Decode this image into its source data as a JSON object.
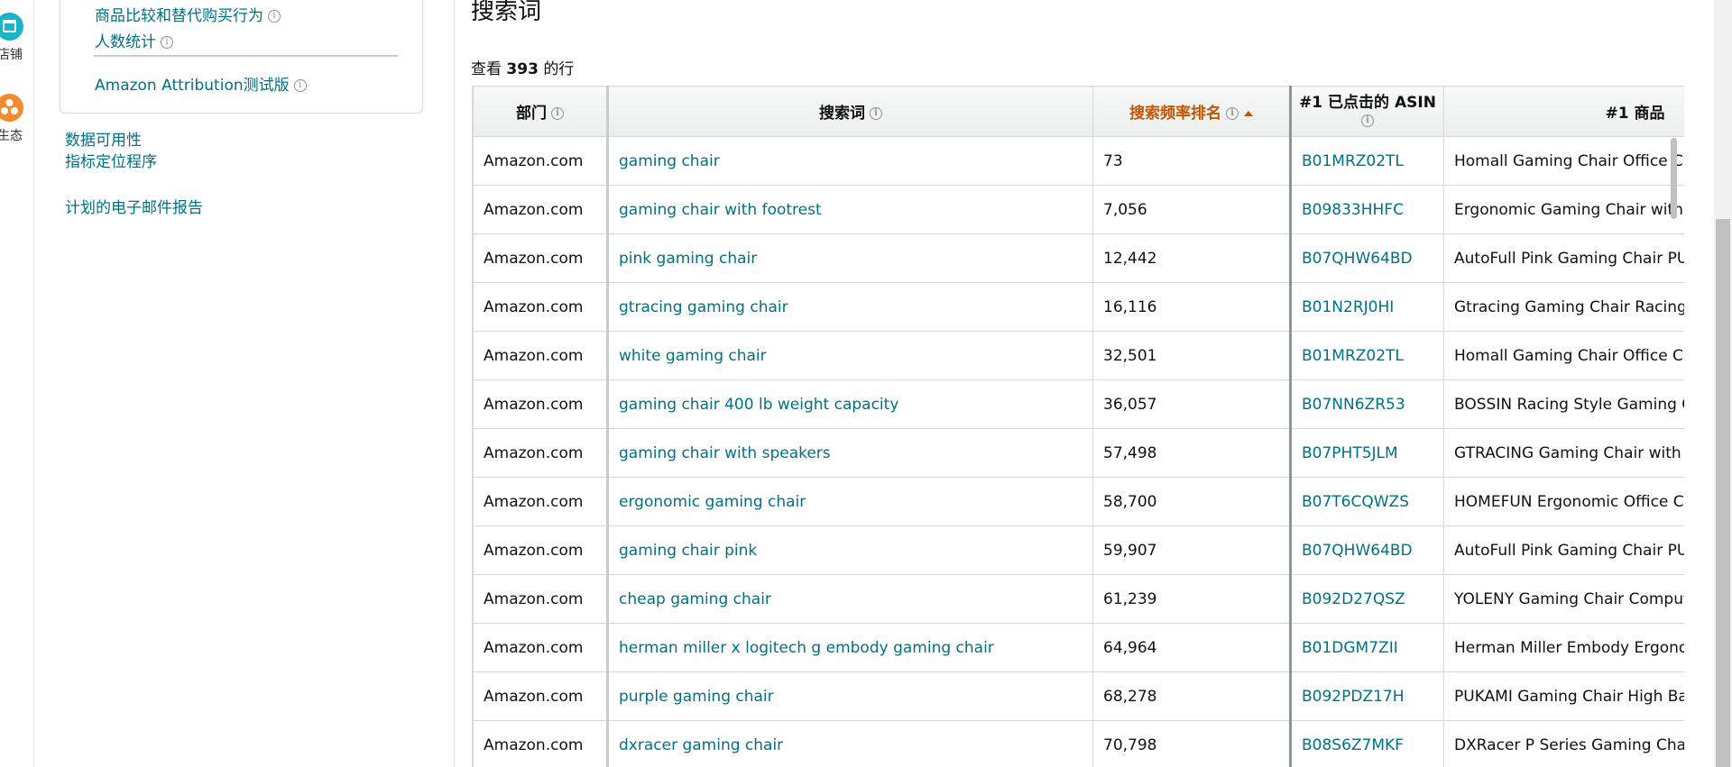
{
  "rail": {
    "items": [
      {
        "label": "店铺",
        "icon": "store-icon",
        "color": "#1ab4c8"
      },
      {
        "label": "生态",
        "icon": "ecosystem-icon",
        "color": "#f58b2c"
      }
    ]
  },
  "sidebar": {
    "box_links": [
      {
        "label": "商品比较和替代购买行为",
        "info": "i"
      },
      {
        "label": "人数统计",
        "info": "i"
      },
      {
        "label": "Amazon Attribution测试版",
        "info": "i"
      }
    ],
    "links": [
      {
        "label": "数据可用性"
      },
      {
        "label": "指标定位程序"
      },
      {
        "label": "计划的电子邮件报告"
      }
    ]
  },
  "main": {
    "title": "搜索词",
    "row_count_prefix": "查看",
    "row_count_value": "393",
    "row_count_suffix": "的行",
    "columns": {
      "department": "部门",
      "search_term": "搜索词",
      "rank": "搜索频率排名",
      "asin": "#1 已点击的 ASIN",
      "product": "#1 商品"
    },
    "rows": [
      {
        "department": "Amazon.com",
        "term": "gaming chair",
        "rank": "73",
        "asin": "B01MRZ02TL",
        "product": "Homall Gaming Chair Office Chair High Back"
      },
      {
        "department": "Amazon.com",
        "term": "gaming chair with footrest",
        "rank": "7,056",
        "asin": "B09833HHFC",
        "product": "Ergonomic Gaming Chair with Footrest"
      },
      {
        "department": "Amazon.com",
        "term": "pink gaming chair",
        "rank": "12,442",
        "asin": "B07QHW64BD",
        "product": "AutoFull Pink Gaming Chair PU Leather"
      },
      {
        "department": "Amazon.com",
        "term": "gtracing gaming chair",
        "rank": "16,116",
        "asin": "B01N2RJ0HI",
        "product": "Gtracing Gaming Chair Racing Office"
      },
      {
        "department": "Amazon.com",
        "term": "white gaming chair",
        "rank": "32,501",
        "asin": "B01MRZ02TL",
        "product": "Homall Gaming Chair Office Chair High Back"
      },
      {
        "department": "Amazon.com",
        "term": "gaming chair 400 lb weight capacity",
        "rank": "36,057",
        "asin": "B07NN6ZR53",
        "product": "BOSSIN Racing Style Gaming Chair"
      },
      {
        "department": "Amazon.com",
        "term": "gaming chair with speakers",
        "rank": "57,498",
        "asin": "B07PHT5JLM",
        "product": "GTRACING Gaming Chair with Speakers"
      },
      {
        "department": "Amazon.com",
        "term": "ergonomic gaming chair",
        "rank": "58,700",
        "asin": "B07T6CQWZS",
        "product": "HOMEFUN Ergonomic Office Chair"
      },
      {
        "department": "Amazon.com",
        "term": "gaming chair pink",
        "rank": "59,907",
        "asin": "B07QHW64BD",
        "product": "AutoFull Pink Gaming Chair PU Leather"
      },
      {
        "department": "Amazon.com",
        "term": "cheap gaming chair",
        "rank": "61,239",
        "asin": "B092D27QSZ",
        "product": "YOLENY Gaming Chair Computer Chair"
      },
      {
        "department": "Amazon.com",
        "term": "herman miller x logitech g embody gaming chair",
        "rank": "64,964",
        "asin": "B01DGM7ZII",
        "product": "Herman Miller Embody Ergonomic Chair"
      },
      {
        "department": "Amazon.com",
        "term": "purple gaming chair",
        "rank": "68,278",
        "asin": "B092PDZ17H",
        "product": "PUKAMI Gaming Chair High Back"
      },
      {
        "department": "Amazon.com",
        "term": "dxracer gaming chair",
        "rank": "70,798",
        "asin": "B08S6Z7MKF",
        "product": "DXRacer P Series Gaming Chair, Racing"
      }
    ]
  },
  "colors": {
    "link": "#007185",
    "sorted": "#c45500"
  }
}
